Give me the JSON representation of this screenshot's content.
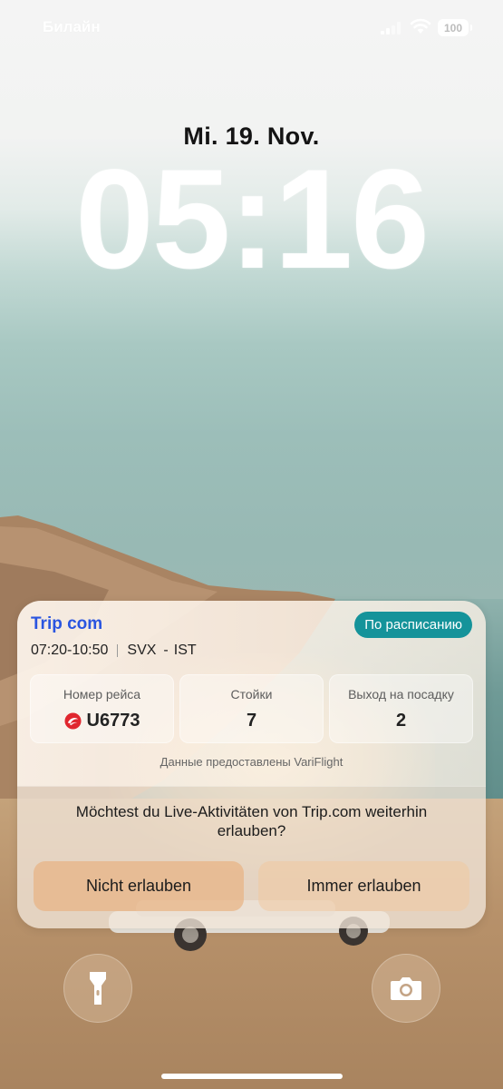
{
  "status_bar": {
    "carrier": "Билайн",
    "battery": "100"
  },
  "lock_screen": {
    "date": "Mi. 19. Nov.",
    "time": "05:16"
  },
  "live_activity": {
    "brand": "Trip com",
    "status": "По расписанию",
    "departure_arrival": "07:20-10:50",
    "from": "SVX",
    "to": "IST",
    "flight_label": "Номер рейса",
    "flight_number": "U6773",
    "counters_label": "Стойки",
    "counters_value": "7",
    "gate_label": "Выход на посадку",
    "gate_value": "2",
    "provider": "Данные предоставлены VariFlight"
  },
  "permission": {
    "question": "Möchtest du Live-Aktivitäten von Trip.com weiterhin erlauben?",
    "deny_label": "Nicht erlauben",
    "allow_label": "Immer erlauben"
  },
  "colors": {
    "brand_blue": "#2a55e0",
    "status_teal": "#15939a",
    "airline_red": "#e0262e"
  },
  "icons": {
    "signal": "cellular-signal-icon",
    "wifi": "wifi-icon",
    "flashlight": "flashlight-icon",
    "camera": "camera-icon",
    "airline": "ural-airlines-logo-icon"
  }
}
